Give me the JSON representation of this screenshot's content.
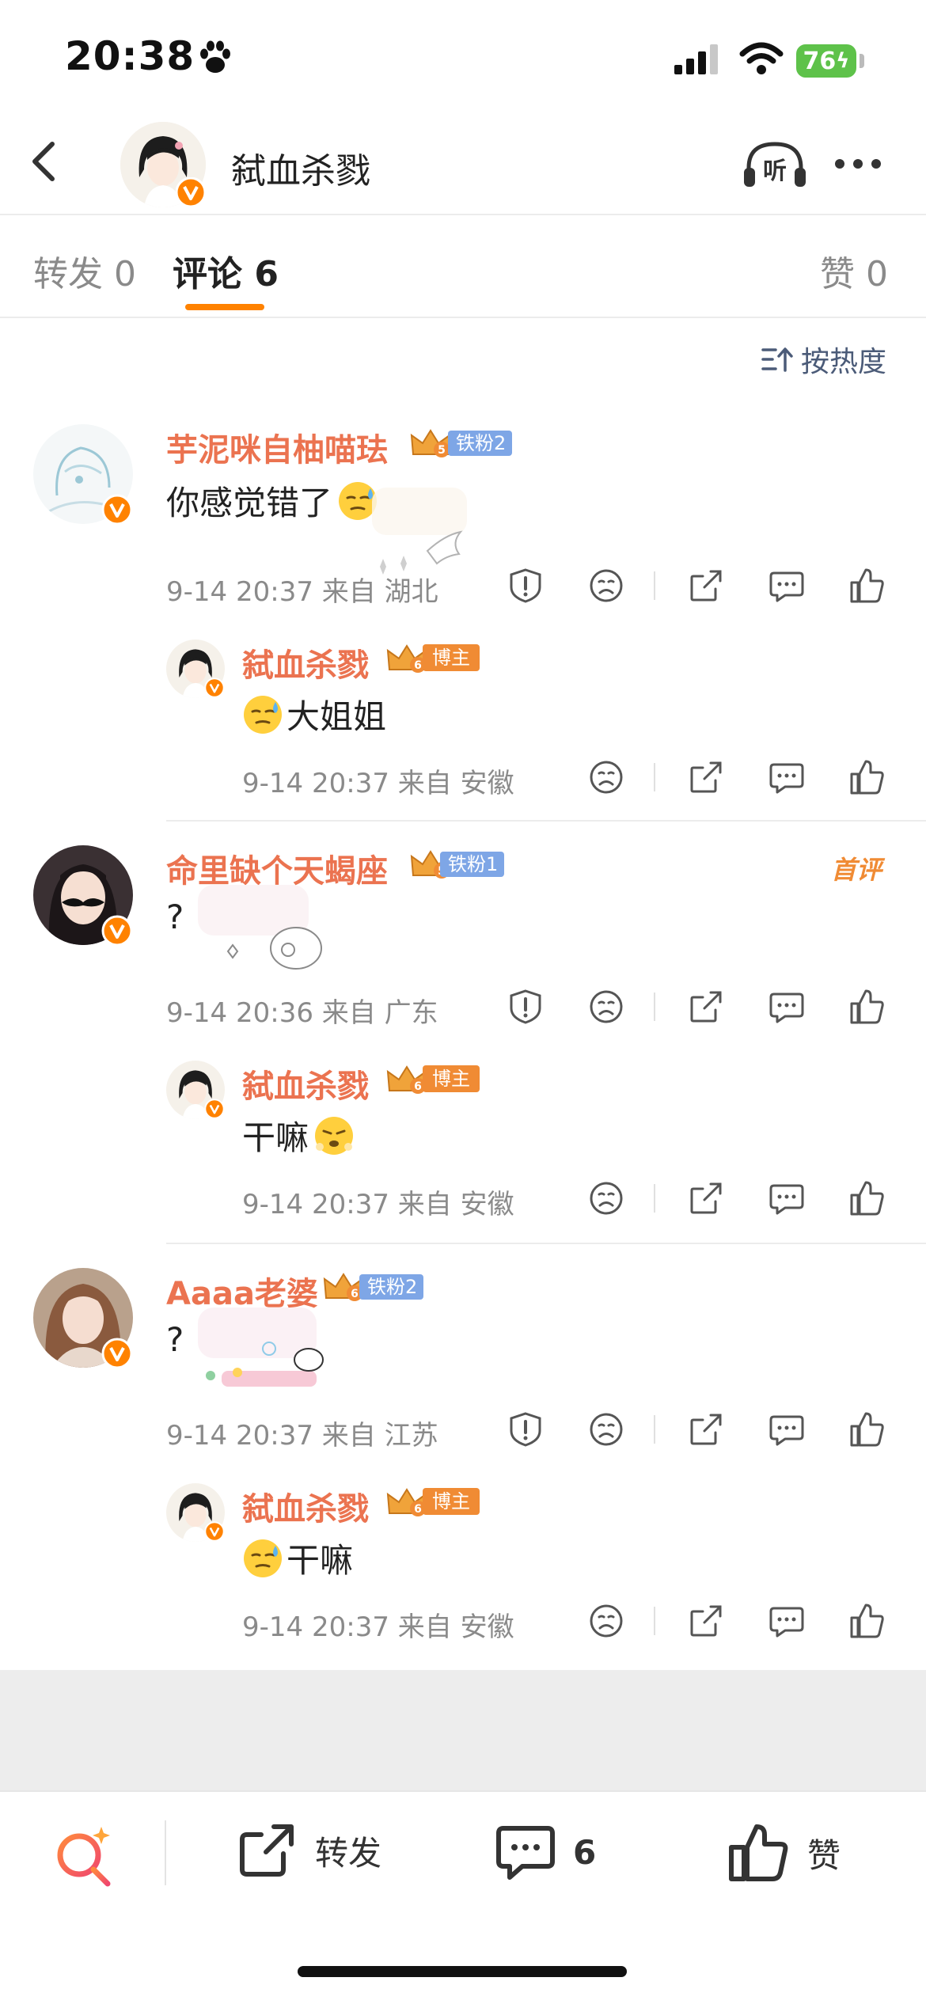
{
  "status_bar": {
    "time": "20:38",
    "battery": "76"
  },
  "header": {
    "title": "弑血杀戮"
  },
  "tabs": [
    {
      "label": "转发 0"
    },
    {
      "label": "评论 6"
    },
    {
      "label": "赞 0"
    }
  ],
  "sort": {
    "label": "按热度"
  },
  "comments": [
    {
      "username": "芋泥咪自柚喵珐",
      "badge_level": "5",
      "fan_tag": "铁粉2",
      "text": "你感觉错了",
      "emoji": "sweat-smile-emoji",
      "meta": "9-14 20:37 来自 湖北",
      "reply": {
        "username": "弑血杀戮",
        "badge_level": "6",
        "tag": "博主",
        "text": "大姐姐",
        "emoji": "sweat-smile-emoji",
        "meta": "9-14 20:37 来自 安徽"
      }
    },
    {
      "username": "命里缺个天蝎座",
      "badge_level": "5",
      "fan_tag": "铁粉1",
      "first_label": "首评",
      "text": "?",
      "meta": "9-14 20:36 来自 广东",
      "reply": {
        "username": "弑血杀戮",
        "badge_level": "6",
        "tag": "博主",
        "text": "干嘛",
        "emoji": "huffing-emoji",
        "meta": "9-14 20:37 来自 安徽"
      }
    },
    {
      "username": "Aaaa老婆",
      "badge_level": "6",
      "fan_tag": "铁粉2",
      "text": "?",
      "meta": "9-14 20:37 来自 江苏",
      "reply": {
        "username": "弑血杀戮",
        "badge_level": "6",
        "tag": "博主",
        "text": "干嘛",
        "emoji": "sweat-smile-emoji",
        "meta": "9-14 20:37 来自 安徽"
      }
    }
  ],
  "bottom_bar": {
    "repost_label": "转发",
    "comment_count": "6",
    "like_label": "赞"
  },
  "colors": {
    "accent": "#ff8200",
    "username": "#eb7350",
    "fan_tag": "#7ea6e6",
    "blogger_tag": "#f08b34",
    "meta": "#8a8a8a"
  }
}
